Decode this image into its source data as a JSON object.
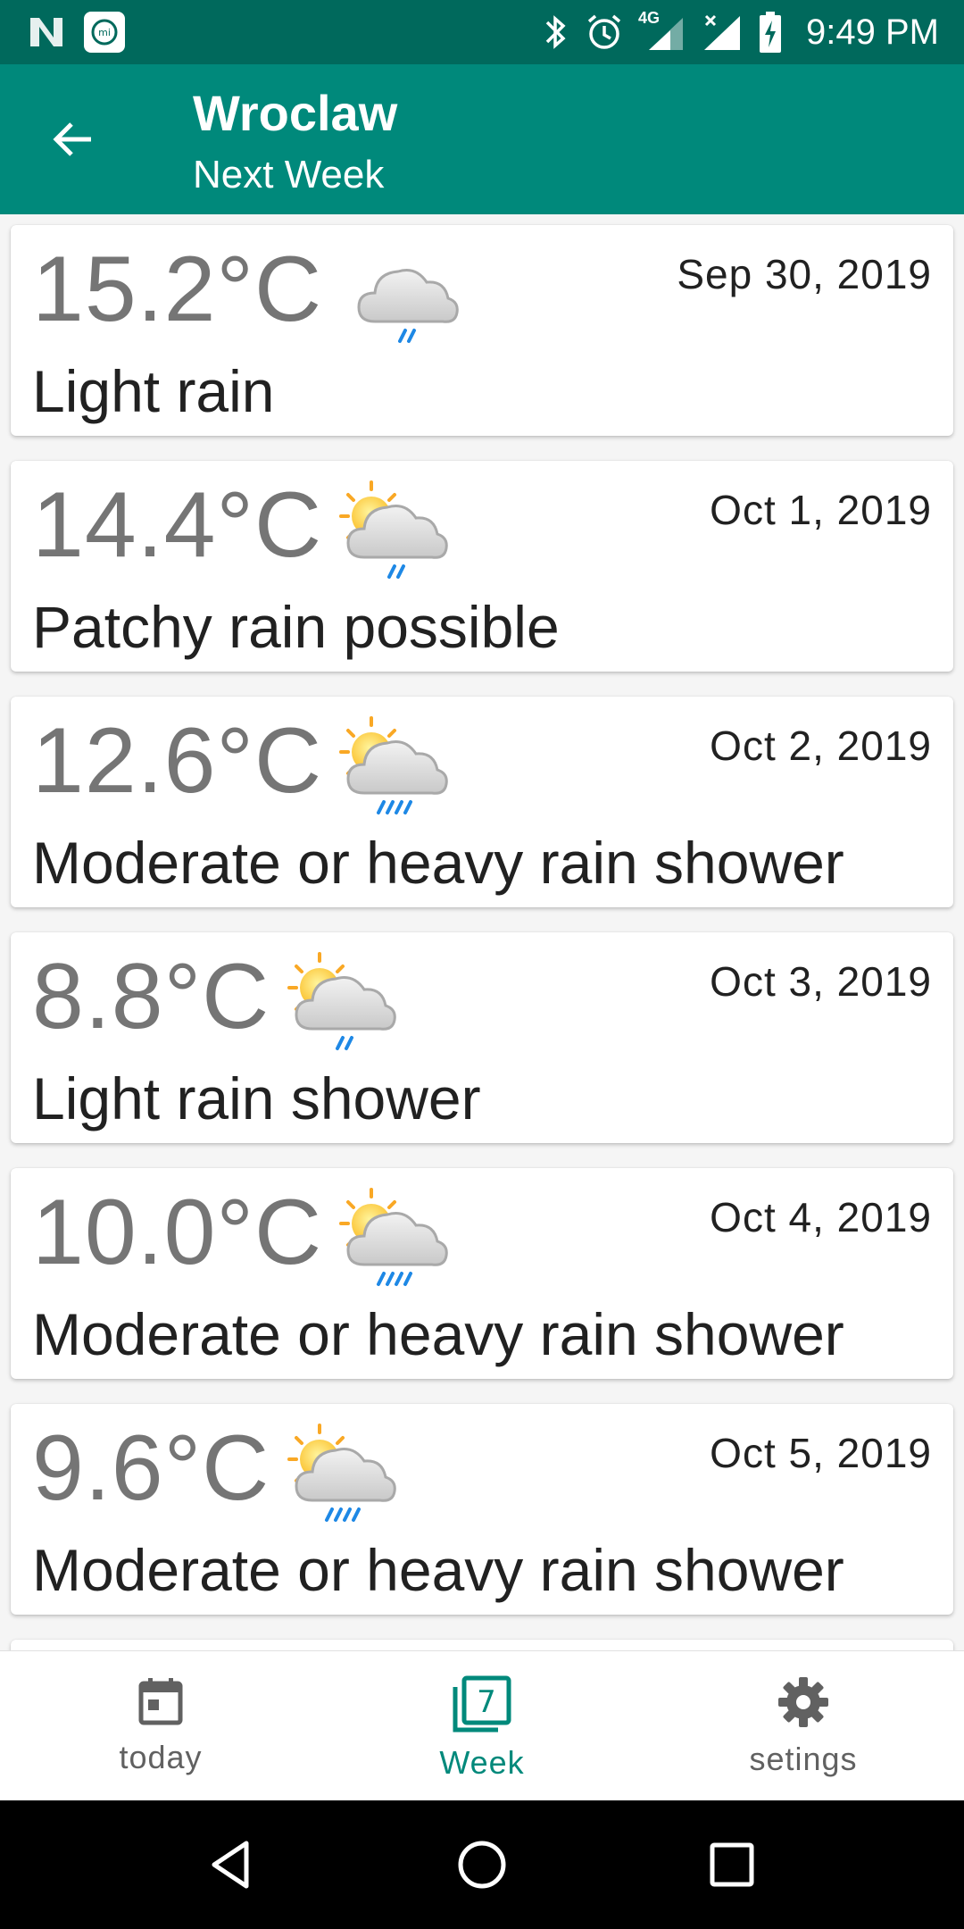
{
  "status_bar": {
    "time": "9:49 PM",
    "network": "4G"
  },
  "app_bar": {
    "title": "Wroclaw",
    "subtitle": "Next Week"
  },
  "forecast": [
    {
      "temp": "15.2°C",
      "date": "Sep 30, 2019",
      "condition": "Light rain",
      "icon": "cloud-rain-icon"
    },
    {
      "temp": "14.4°C",
      "date": "Oct 1, 2019",
      "condition": "Patchy rain possible",
      "icon": "sun-cloud-rain-icon"
    },
    {
      "temp": "12.6°C",
      "date": "Oct 2, 2019",
      "condition": "Moderate or heavy rain shower",
      "icon": "sun-cloud-heavy-rain-icon"
    },
    {
      "temp": "8.8°C",
      "date": "Oct 3, 2019",
      "condition": "Light rain shower",
      "icon": "sun-cloud-rain-icon"
    },
    {
      "temp": "10.0°C",
      "date": "Oct 4, 2019",
      "condition": "Moderate or heavy rain shower",
      "icon": "sun-cloud-heavy-rain-icon"
    },
    {
      "temp": "9.6°C",
      "date": "Oct 5, 2019",
      "condition": "Moderate or heavy rain shower",
      "icon": "sun-cloud-heavy-rain-icon"
    }
  ],
  "bottom_nav": {
    "today": "today",
    "week": "Week",
    "week_badge": "7",
    "settings": "setings"
  },
  "colors": {
    "status_bar": "#00695c",
    "app_bar": "#00897b",
    "accent": "#00897b"
  }
}
